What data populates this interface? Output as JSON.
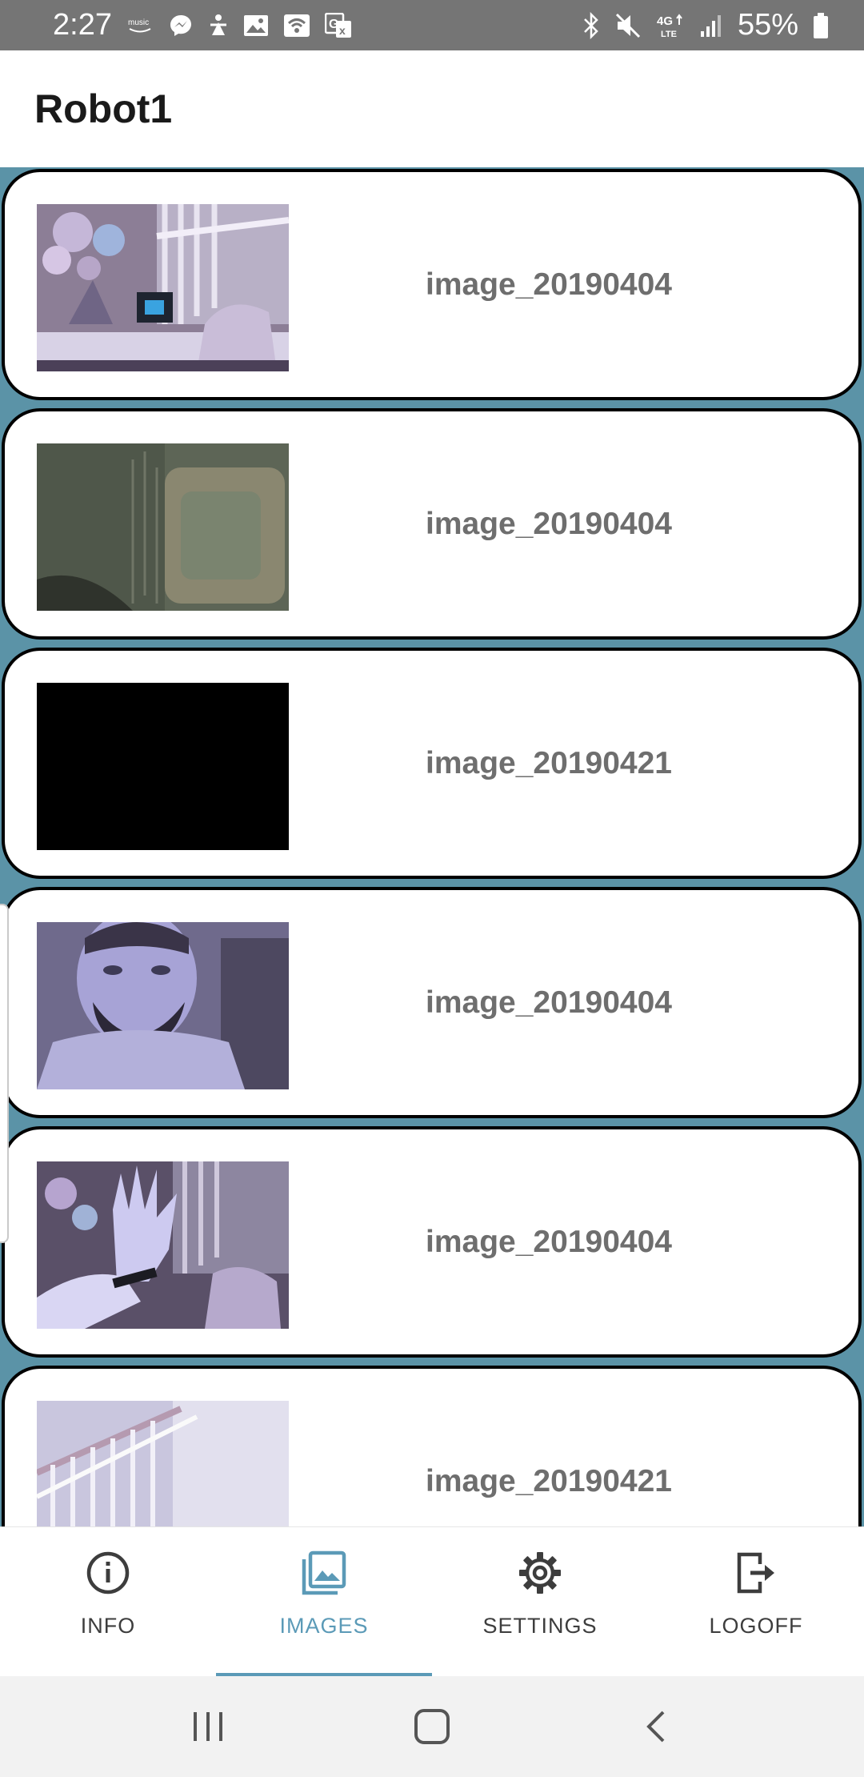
{
  "status_bar": {
    "time": "2:27",
    "battery_percent": "55%",
    "left_icons": [
      "amazon-music-icon",
      "messenger-icon",
      "figure-icon",
      "image-icon",
      "wifi-calling-icon",
      "translate-icon"
    ],
    "right_icons": [
      "bluetooth-icon",
      "mute-icon",
      "lte-icon",
      "signal-icon",
      "battery-icon"
    ]
  },
  "app_bar": {
    "title": "Robot1"
  },
  "images": [
    {
      "label": "image_20190404",
      "thumbnail": "flowers-and-stairs"
    },
    {
      "label": "image_20190404",
      "thumbnail": "close-up-fabric"
    },
    {
      "label": "image_20190421",
      "thumbnail": "dark"
    },
    {
      "label": "image_20190404",
      "thumbnail": "face"
    },
    {
      "label": "image_20190404",
      "thumbnail": "raised-hand"
    },
    {
      "label": "image_20190421",
      "thumbnail": "stairs-and-face"
    }
  ],
  "bottom_nav": {
    "active": "IMAGES",
    "items": [
      {
        "label": "INFO",
        "icon": "info-icon"
      },
      {
        "label": "IMAGES",
        "icon": "images-icon"
      },
      {
        "label": "SETTINGS",
        "icon": "gear-icon"
      },
      {
        "label": "LOGOFF",
        "icon": "logoff-icon"
      }
    ]
  },
  "system_nav": [
    "recents-icon",
    "home-icon",
    "back-icon"
  ],
  "colors": {
    "accent": "#5b9ab7",
    "list_background": "#5b93a7",
    "status_bar": "#757575",
    "label_text": "#6e6e6e"
  }
}
